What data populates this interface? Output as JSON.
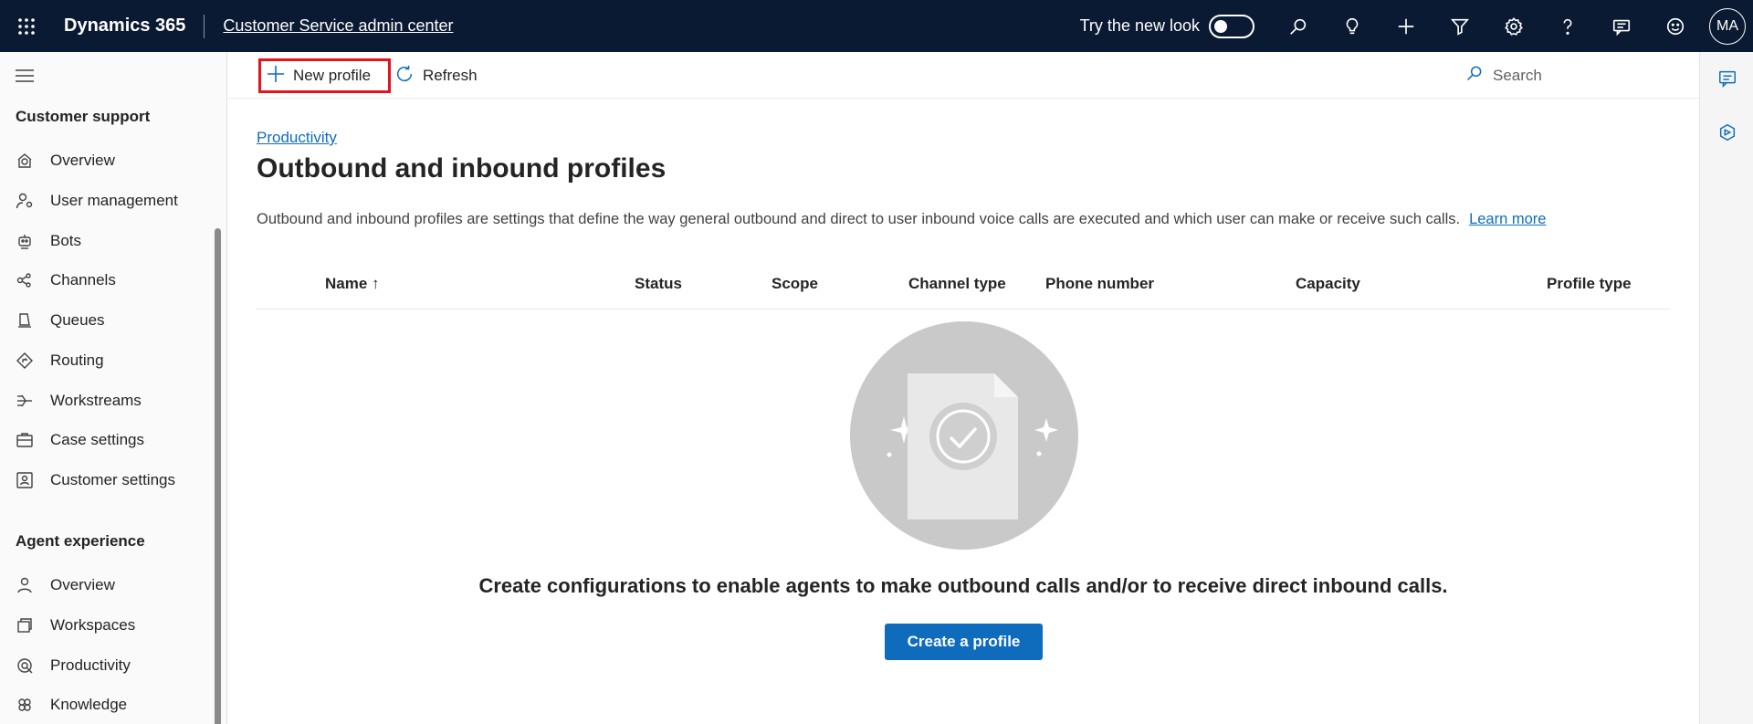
{
  "topbar": {
    "brand": "Dynamics 365",
    "app_name": "Customer Service admin center",
    "try_new_look": "Try the new look",
    "toggle_on": false,
    "avatar_initials": "MA",
    "icons": [
      "search-icon",
      "lightbulb-icon",
      "plus-icon",
      "filter-icon",
      "gear-icon",
      "help-icon",
      "chat-icon",
      "smiley-icon"
    ]
  },
  "sidebar": {
    "section1": "Customer support",
    "items1": [
      {
        "label": "Overview",
        "icon": "overview-icon"
      },
      {
        "label": "User management",
        "icon": "user-management-icon"
      },
      {
        "label": "Bots",
        "icon": "bot-icon"
      },
      {
        "label": "Channels",
        "icon": "channels-icon"
      },
      {
        "label": "Queues",
        "icon": "queues-icon"
      },
      {
        "label": "Routing",
        "icon": "routing-icon"
      },
      {
        "label": "Workstreams",
        "icon": "workstreams-icon"
      },
      {
        "label": "Case settings",
        "icon": "case-settings-icon"
      },
      {
        "label": "Customer settings",
        "icon": "customer-settings-icon"
      }
    ],
    "section2": "Agent experience",
    "items2": [
      {
        "label": "Overview",
        "icon": "person-icon"
      },
      {
        "label": "Workspaces",
        "icon": "workspaces-icon"
      },
      {
        "label": "Productivity",
        "icon": "productivity-icon"
      },
      {
        "label": "Knowledge",
        "icon": "knowledge-icon"
      }
    ]
  },
  "commandbar": {
    "new_profile": "New profile",
    "refresh": "Refresh",
    "search_placeholder": "Search"
  },
  "main": {
    "breadcrumb": "Productivity",
    "title": "Outbound and inbound profiles",
    "description": "Outbound and inbound profiles are settings that define the way general outbound and direct to user inbound voice calls are executed and which user can make or receive such calls.",
    "learn_more": "Learn more",
    "columns": [
      "Name ↑",
      "Status",
      "Scope",
      "Channel type",
      "Phone number",
      "Capacity",
      "Profile type"
    ],
    "empty_message": "Create configurations to enable agents to make outbound calls and/or to receive direct inbound calls.",
    "create_button": "Create a profile"
  },
  "colors": {
    "topbar_bg": "#0b1a33",
    "accent": "#0f6cbd",
    "highlight_border": "#e3141b"
  }
}
